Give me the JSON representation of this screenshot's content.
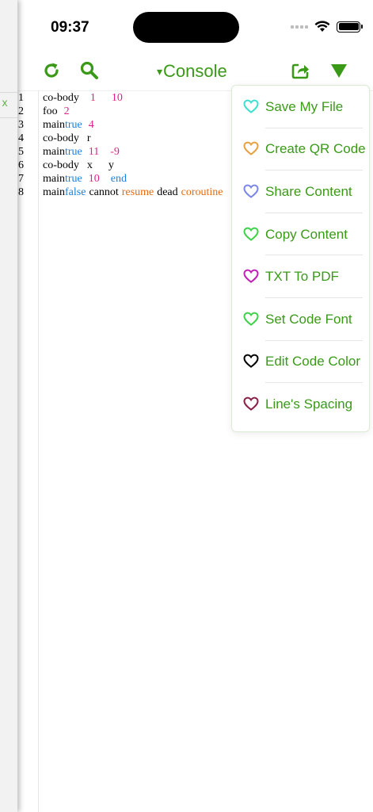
{
  "status_bar": {
    "time": "09:37"
  },
  "left_panel": {
    "close_label": "x"
  },
  "toolbar": {
    "title_arrow": "▾",
    "title": "Console",
    "accent_color": "#3a9a18"
  },
  "code_lines": [
    {
      "num": "1",
      "tokens": [
        {
          "t": "co-body",
          "c": ""
        },
        {
          "t": "1",
          "c": "n",
          "gap": 14
        },
        {
          "t": "10",
          "c": "n",
          "gap": 20
        }
      ]
    },
    {
      "num": "2",
      "tokens": [
        {
          "t": "foo",
          "c": ""
        },
        {
          "t": "2",
          "c": "n",
          "gap": 8
        }
      ]
    },
    {
      "num": "3",
      "tokens": [
        {
          "t": "main",
          "c": ""
        },
        {
          "t": "true",
          "c": "k",
          "gap": 0
        },
        {
          "t": "4",
          "c": "n",
          "gap": 8
        }
      ]
    },
    {
      "num": "4",
      "tokens": [
        {
          "t": "co-body",
          "c": ""
        },
        {
          "t": "r",
          "c": "",
          "gap": 10
        }
      ]
    },
    {
      "num": "5",
      "tokens": [
        {
          "t": "main",
          "c": ""
        },
        {
          "t": "true",
          "c": "k",
          "gap": 0
        },
        {
          "t": "11",
          "c": "n",
          "gap": 8
        },
        {
          "t": "-9",
          "c": "n",
          "gap": 14
        }
      ]
    },
    {
      "num": "6",
      "tokens": [
        {
          "t": "co-body",
          "c": ""
        },
        {
          "t": "x",
          "c": "",
          "gap": 10
        },
        {
          "t": "y",
          "c": "",
          "gap": 20
        }
      ]
    },
    {
      "num": "7",
      "tokens": [
        {
          "t": "main",
          "c": ""
        },
        {
          "t": "true",
          "c": "k",
          "gap": 0
        },
        {
          "t": "10",
          "c": "n",
          "gap": 8
        },
        {
          "t": "end",
          "c": "k",
          "gap": 14
        }
      ]
    },
    {
      "num": "8",
      "tokens": [
        {
          "t": "main",
          "c": ""
        },
        {
          "t": "false",
          "c": "k",
          "gap": 0
        },
        {
          "t": "cannot",
          "c": "",
          "gap": 4
        },
        {
          "t": "resume",
          "c": "o",
          "gap": 4
        },
        {
          "t": "dead",
          "c": "",
          "gap": 4
        },
        {
          "t": "coroutine",
          "c": "o",
          "gap": 4
        }
      ]
    }
  ],
  "menu": {
    "items": [
      {
        "label": "Save My File",
        "heart_color": "#3ee0d0"
      },
      {
        "label": "Create QR Code",
        "heart_color": "#e8a040"
      },
      {
        "label": "Share Content",
        "heart_color": "#7b86e8"
      },
      {
        "label": "Copy Content",
        "heart_color": "#3ed24a"
      },
      {
        "label": "TXT To PDF",
        "heart_color": "#c21fb8"
      },
      {
        "label": "Set Code Font",
        "heart_color": "#3ed24a"
      },
      {
        "label": "Edit Code Color",
        "heart_color": "#000000"
      },
      {
        "label": "Line's Spacing",
        "heart_color": "#8a2048"
      }
    ]
  }
}
